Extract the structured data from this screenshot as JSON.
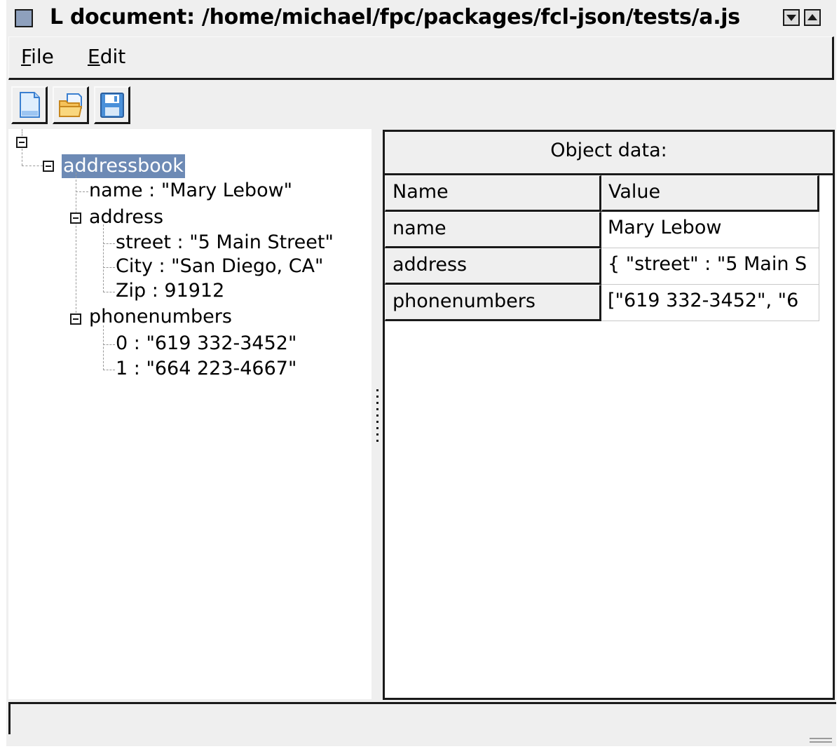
{
  "window": {
    "title": "L document: /home/michael/fpc/packages/fcl-json/tests/a.js"
  },
  "menu": {
    "items": [
      {
        "accel": "F",
        "rest": "ile"
      },
      {
        "accel": "E",
        "rest": "dit"
      }
    ]
  },
  "toolbar": {
    "buttons": [
      "new-document-icon",
      "open-folder-icon",
      "save-disk-icon"
    ]
  },
  "tree": {
    "nodes": [
      {
        "label": "addressbook",
        "selected": true
      },
      {
        "label": "name : \"Mary Lebow\""
      },
      {
        "label": "address"
      },
      {
        "label": "street : \"5 Main Street\""
      },
      {
        "label": "City : \"San Diego, CA\""
      },
      {
        "label": "Zip : 91912"
      },
      {
        "label": "phonenumbers"
      },
      {
        "label": "0 : \"619 332-3452\""
      },
      {
        "label": "1 : \"664 223-4667\""
      }
    ]
  },
  "object_panel": {
    "title": "Object data:",
    "columns": [
      "Name",
      "Value"
    ],
    "rows": [
      {
        "name": "name",
        "value": "Mary Lebow"
      },
      {
        "name": "address",
        "value": "{ \"street\" : \"5 Main S"
      },
      {
        "name": "phonenumbers",
        "value": "[\"619 332-3452\", \"6"
      }
    ]
  },
  "colors": {
    "selection": "#6d8ab5",
    "window_bg": "#efefef"
  }
}
